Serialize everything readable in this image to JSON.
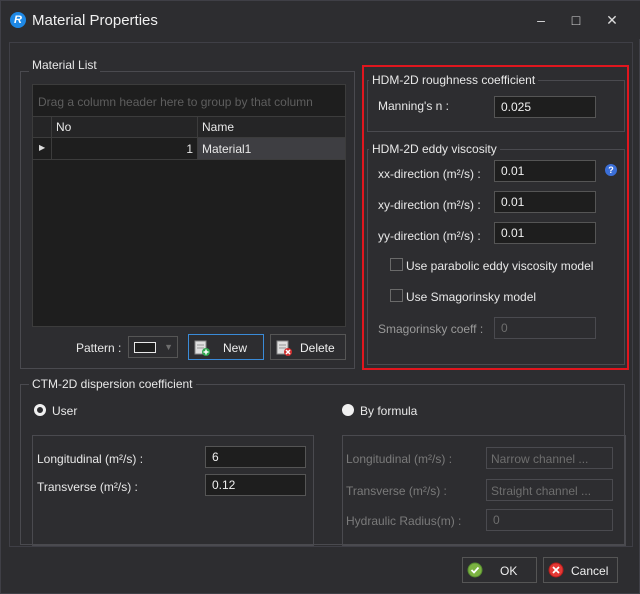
{
  "window": {
    "title": "Material Properties",
    "app_icon_letter": "R",
    "minimize_glyph": "–",
    "maximize_glyph": "□",
    "close_glyph": "✕"
  },
  "material_list": {
    "group_label": "Material List",
    "group_panel_hint": "Drag a column header here to group by that column",
    "columns": [
      "No",
      "Name"
    ],
    "rows": [
      {
        "no": "1",
        "name": "Material1"
      }
    ],
    "pattern_label": "Pattern :",
    "new_label": "New",
    "delete_label": "Delete"
  },
  "roughness": {
    "group_label": "HDM-2D roughness coefficient",
    "mannings_label": "Manning's n :",
    "mannings_value": "0.025"
  },
  "eddy": {
    "group_label": "HDM-2D eddy viscosity",
    "xx_label": "xx-direction (m²/s) :",
    "xx_value": "0.01",
    "xy_label": "xy-direction (m²/s) :",
    "xy_value": "0.01",
    "yy_label": "yy-direction (m²/s) :",
    "yy_value": "0.01",
    "parabolic_label": "Use parabolic eddy viscosity model",
    "parabolic_checked": false,
    "smagorinsky_label": "Use Smagorinsky model",
    "smagorinsky_checked": false,
    "smag_coeff_label": "Smagorinsky coeff :",
    "smag_coeff_value": "0"
  },
  "dispersion": {
    "group_label": "CTM-2D dispersion coefficient",
    "user_label": "User",
    "user_selected": true,
    "formula_label": "By formula",
    "formula_selected": false,
    "user_longitudinal_label": "Longitudinal (m²/s) :",
    "user_longitudinal_value": "6",
    "user_transverse_label": "Transverse (m²/s) :",
    "user_transverse_value": "0.12",
    "formula_longitudinal_label": "Longitudinal (m²/s) :",
    "formula_longitudinal_value": "Narrow channel ...",
    "formula_transverse_label": "Transverse (m²/s) :",
    "formula_transverse_value": "Straight channel ...",
    "formula_hydraulic_label": "Hydraulic Radius(m) :",
    "formula_hydraulic_value": "0"
  },
  "footer": {
    "ok_label": "OK",
    "cancel_label": "Cancel"
  },
  "colors": {
    "background": "#2d2d30",
    "highlight_border": "#e0161e",
    "selected_row": "#3e3e42",
    "help_icon": "#3b6fd8"
  }
}
